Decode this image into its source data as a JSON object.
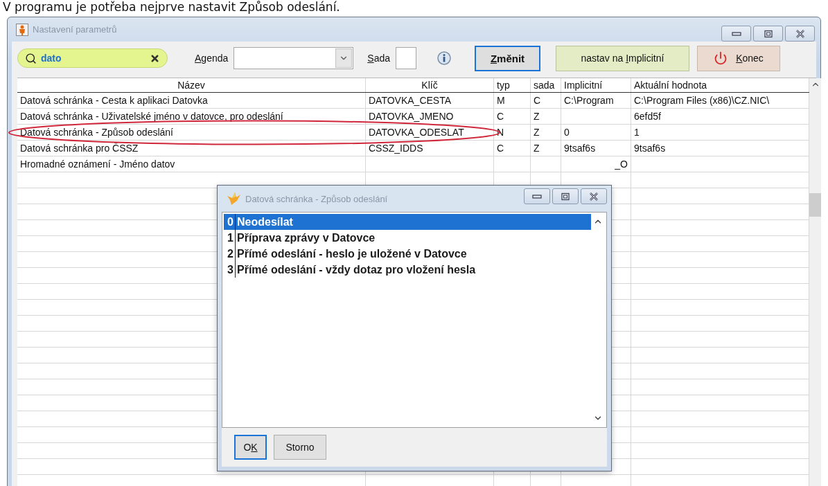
{
  "caption": "V programu je potřeba nejprve nastavit Způsob odeslání.",
  "window": {
    "title": "Nastavení parametrů"
  },
  "toolbar": {
    "search": {
      "value": "dato"
    },
    "agenda": {
      "mnemonic": "A",
      "after": "genda"
    },
    "sada": {
      "mnemonic": "S",
      "after": "ada"
    },
    "buttons": [
      {
        "mnemonic": "Z",
        "after": "měnit",
        "kind": "default"
      },
      {
        "before": "nastav na ",
        "mnemonic": "I",
        "after": "mplicitní",
        "kind": "reset"
      },
      {
        "mnemonic": "K",
        "after": "onec",
        "kind": "exit"
      }
    ]
  },
  "table": {
    "columns": [
      "Název",
      "Klíč",
      "typ",
      "sada",
      "Implicitní",
      "Aktuální hodnota"
    ],
    "rows": [
      {
        "name": "Datová schránka - Cesta k aplikaci Datovka",
        "key": "DATOVKA_CESTA",
        "type": "M",
        "set": "C",
        "default": "C:\\Program",
        "current": "C:\\Program Files (x86)\\CZ.NIC\\",
        "circled": false
      },
      {
        "name": "Datová schránka - Uživatelské jméno v datovce, pro odeslání",
        "key": "DATOVKA_JMENO",
        "type": "C",
        "set": "Z",
        "current": "6efd5f",
        "circled": false
      },
      {
        "name": "Datová schránka - Způsob odeslání",
        "key": "DATOVKA_ODESLAT",
        "type": "N",
        "set": "Z",
        "default": "0",
        "current": "1",
        "circled": true
      },
      {
        "name": "Datová schránka pro ČSSZ",
        "key": "CSSZ_IDDS",
        "type": "C",
        "set": "Z",
        "default": "9tsaf6s",
        "current": "9tsaf6s",
        "circled": false
      },
      {
        "name": "Hromadné oznámení -  Jméno datov",
        "default": "_O",
        "circled": false
      }
    ]
  },
  "dialog": {
    "title": "Datová schránka - Způsob odeslání",
    "options": [
      {
        "code": "0",
        "label": "Neodesílat",
        "selected": true
      },
      {
        "code": "1",
        "label": "Příprava zprávy v Datovce",
        "selected": false
      },
      {
        "code": "2",
        "label": "Přímé odeslání - heslo je uložené v Datovce",
        "selected": false
      },
      {
        "code": "3",
        "label": "Přímé odeslání - vždy dotaz pro vložení hesla",
        "selected": false
      }
    ],
    "buttons": [
      {
        "before": "O",
        "mnemonic": "K",
        "kind": "default"
      },
      {
        "before": "Storno",
        "kind": "normal"
      }
    ]
  }
}
